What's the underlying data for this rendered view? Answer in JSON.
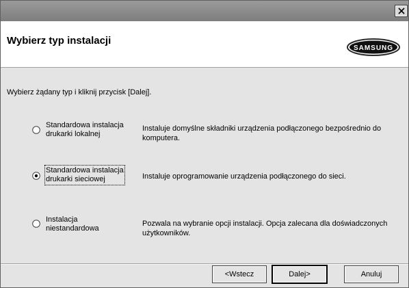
{
  "header": {
    "title": "Wybierz typ instalacji",
    "logo_text": "SAMSUNG"
  },
  "instruction": "Wybierz żądany typ i kliknij przycisk [Dalej].",
  "options": [
    {
      "label_line1": "Standardowa instalacja",
      "label_line2": "drukarki lokalnej",
      "description": "Instaluje domyślne składniki urządzenia podłączonego bezpośrednio do komputera.",
      "selected": false
    },
    {
      "label_line1": "Standardowa instalacja",
      "label_line2": "drukarki sieciowej",
      "description": "Instaluje oprogramowanie urządzenia podłączonego do sieci.",
      "selected": true
    },
    {
      "label_line1": "Instalacja",
      "label_line2": "niestandardowa",
      "description": "Pozwala na wybranie opcji instalacji. Opcja zalecana dla doświadczonych użytkowników.",
      "selected": false
    }
  ],
  "buttons": {
    "back": "<Wstecz",
    "next": "Dalej>",
    "cancel": "Anuluj"
  },
  "colors": {
    "titlebar": "#8a8a8a",
    "dialog_bg": "#e4e4e4",
    "header_bg": "#ffffff"
  }
}
